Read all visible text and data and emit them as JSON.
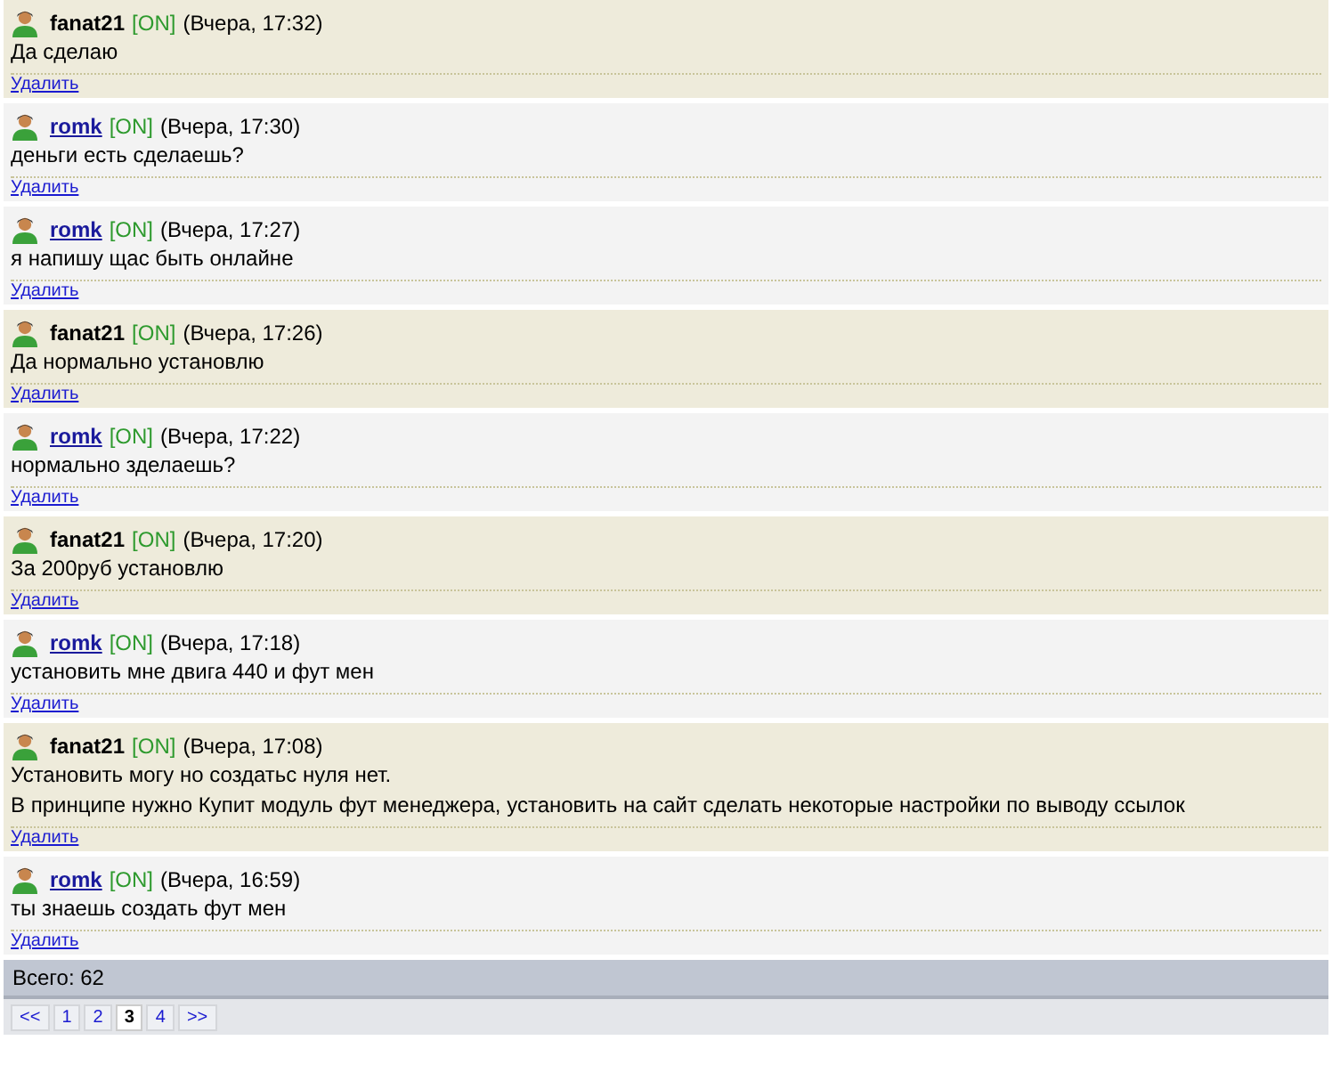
{
  "messages": [
    {
      "author": "fanat21",
      "kind": "self",
      "status": "[ON]",
      "time": "(Вчера, 17:32)",
      "lines": [
        "Да сделаю"
      ],
      "delete": "Удалить"
    },
    {
      "author": "romk",
      "kind": "other",
      "status": "[ON]",
      "time": "(Вчера, 17:30)",
      "lines": [
        "деньги есть сделаешь?"
      ],
      "delete": "Удалить"
    },
    {
      "author": "romk",
      "kind": "other",
      "status": "[ON]",
      "time": "(Вчера, 17:27)",
      "lines": [
        "я напишу щас быть онлайне"
      ],
      "delete": "Удалить"
    },
    {
      "author": "fanat21",
      "kind": "self",
      "status": "[ON]",
      "time": "(Вчера, 17:26)",
      "lines": [
        "Да нормально установлю"
      ],
      "delete": "Удалить"
    },
    {
      "author": "romk",
      "kind": "other",
      "status": "[ON]",
      "time": "(Вчера, 17:22)",
      "lines": [
        "нормально зделаешь?"
      ],
      "delete": "Удалить"
    },
    {
      "author": "fanat21",
      "kind": "self",
      "status": "[ON]",
      "time": "(Вчера, 17:20)",
      "lines": [
        "За 200руб установлю"
      ],
      "delete": "Удалить"
    },
    {
      "author": "romk",
      "kind": "other",
      "status": "[ON]",
      "time": "(Вчера, 17:18)",
      "lines": [
        "установить мне двига 440 и фут мен"
      ],
      "delete": "Удалить"
    },
    {
      "author": "fanat21",
      "kind": "self",
      "status": "[ON]",
      "time": "(Вчера, 17:08)",
      "lines": [
        "Установить могу но создатьс нуля нет.",
        "В принципе нужно Купит модуль фут менеджера, установить на сайт сделать некоторые настройки по выводу ссылок"
      ],
      "delete": "Удалить"
    },
    {
      "author": "romk",
      "kind": "other",
      "status": "[ON]",
      "time": "(Вчера, 16:59)",
      "lines": [
        "ты знаешь создать фут мен"
      ],
      "delete": "Удалить"
    }
  ],
  "total": "Всего: 62",
  "pagination": [
    {
      "label": "<<",
      "selected": false
    },
    {
      "label": "1",
      "selected": false
    },
    {
      "label": "2",
      "selected": false
    },
    {
      "label": "3",
      "selected": true
    },
    {
      "label": "4",
      "selected": false
    },
    {
      "label": ">>",
      "selected": false
    }
  ]
}
